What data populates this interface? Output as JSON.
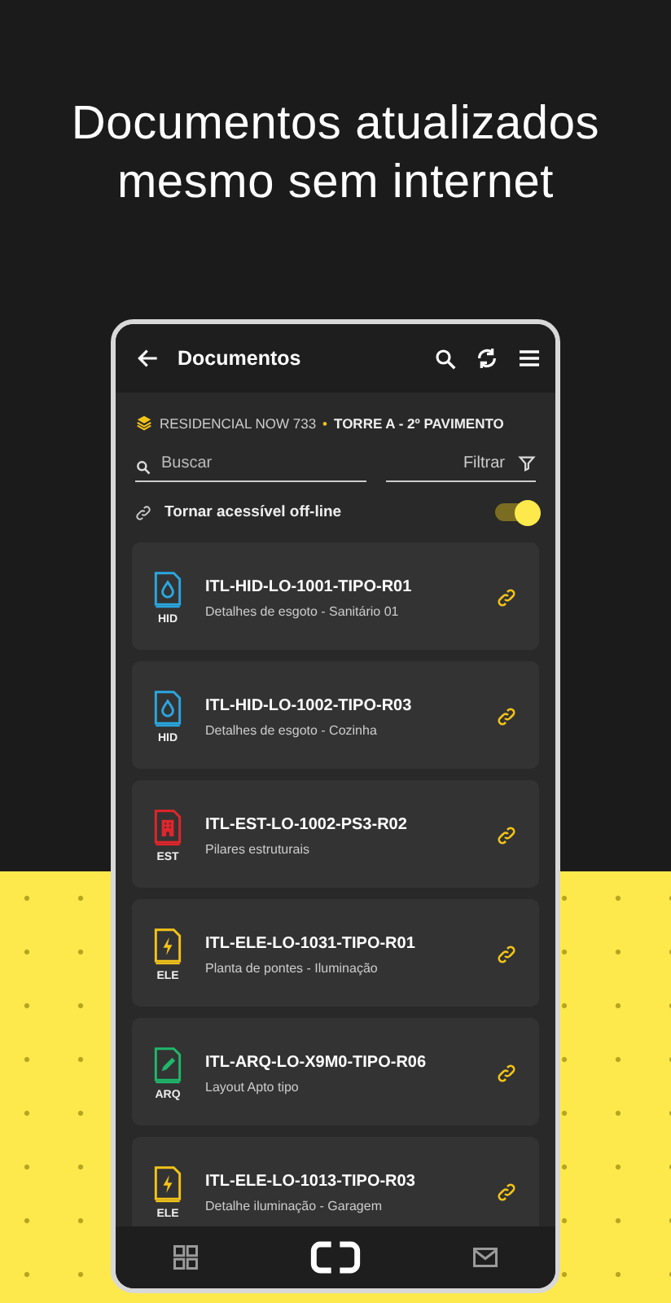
{
  "headline": "Documentos atualizados mesmo sem internet",
  "app_bar": {
    "title": "Documentos"
  },
  "breadcrumb": {
    "project": "RESIDENCIAL NOW 733",
    "separator": "•",
    "location": "TORRE A - 2º PAVIMENTO"
  },
  "search": {
    "placeholder": "Buscar"
  },
  "filter": {
    "label": "Filtrar"
  },
  "offline_toggle": {
    "label": "Tornar acessível off-line",
    "on": true
  },
  "documents": [
    {
      "code": "ITL-HID-LO-1001-TIPO-R01",
      "description": "Detalhes de esgoto - Sanitário 01",
      "discipline": "HID",
      "kind": "water",
      "color": "#2aa7e0"
    },
    {
      "code": "ITL-HID-LO-1002-TIPO-R03",
      "description": "Detalhes de esgoto - Cozinha",
      "discipline": "HID",
      "kind": "water",
      "color": "#2aa7e0"
    },
    {
      "code": "ITL-EST-LO-1002-PS3-R02",
      "description": "Pilares estruturais",
      "discipline": "EST",
      "kind": "building",
      "color": "#e0262b"
    },
    {
      "code": "ITL-ELE-LO-1031-TIPO-R01",
      "description": "Planta de pontes - Iluminação",
      "discipline": "ELE",
      "kind": "bolt",
      "color": "#f2c319"
    },
    {
      "code": "ITL-ARQ-LO-X9M0-TIPO-R06",
      "description": "Layout Apto tipo",
      "discipline": "ARQ",
      "kind": "pencil",
      "color": "#1fb86a"
    },
    {
      "code": "ITL-ELE-LO-1013-TIPO-R03",
      "description": "Detalhe iluminação - Garagem",
      "discipline": "ELE",
      "kind": "bolt",
      "color": "#f2c319"
    }
  ],
  "bottom_nav": [
    {
      "kind": "grid",
      "selected": false
    },
    {
      "kind": "scan",
      "selected": true
    },
    {
      "kind": "mail",
      "selected": false
    }
  ]
}
